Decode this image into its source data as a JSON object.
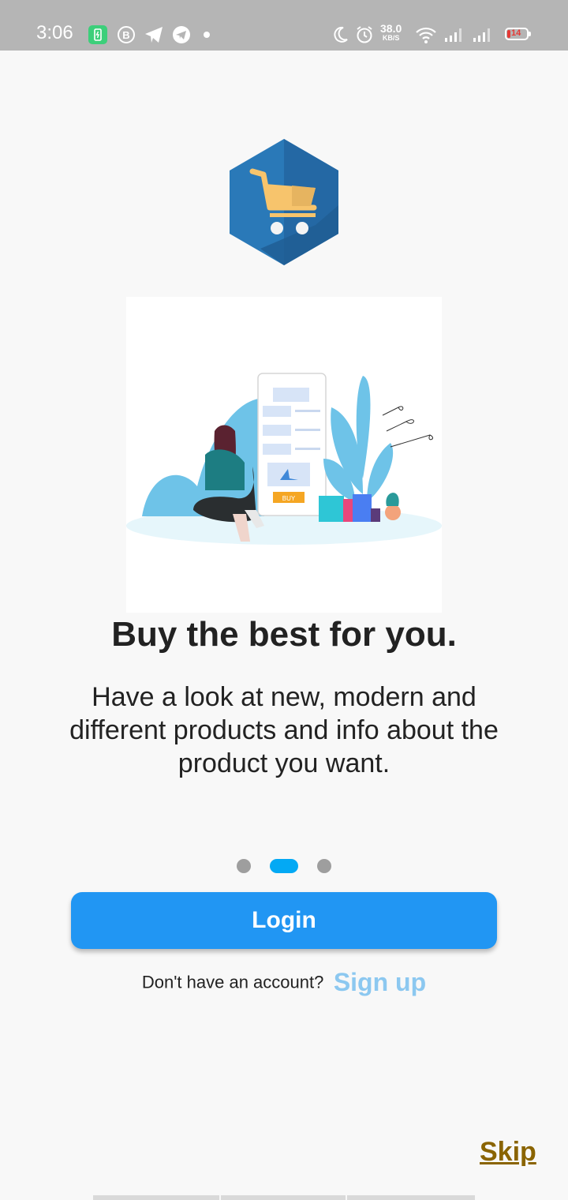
{
  "status_bar": {
    "time": "3:06",
    "speed_value": "38.0",
    "speed_unit": "KB/S",
    "battery_level": "14",
    "icons": [
      "battery-saver-icon",
      "b-notification-icon",
      "telegram-icon",
      "telegram-circle-icon",
      "dot-icon",
      "moon-icon",
      "alarm-icon",
      "wifi-icon",
      "signal-icon",
      "signal-icon"
    ]
  },
  "onboarding": {
    "title": "Buy the best for you.",
    "subtitle": "Have a look at new, modern and different products and info about the product you want.",
    "page_indicator": {
      "count": 3,
      "active_index": 1
    },
    "hero_buy_label": "BUY"
  },
  "actions": {
    "login_label": "Login",
    "signup_question": "Don't have an account?",
    "signup_label": "Sign up",
    "skip_label": "Skip"
  },
  "colors": {
    "primary": "#2196f3",
    "indicator_active": "#03a9f4",
    "indicator_inactive": "#9e9e9e",
    "signup_link": "#8cc8f0",
    "skip": "#8a6400",
    "logo_blue": "#2a79b8",
    "logo_cart": "#f7c46c"
  }
}
